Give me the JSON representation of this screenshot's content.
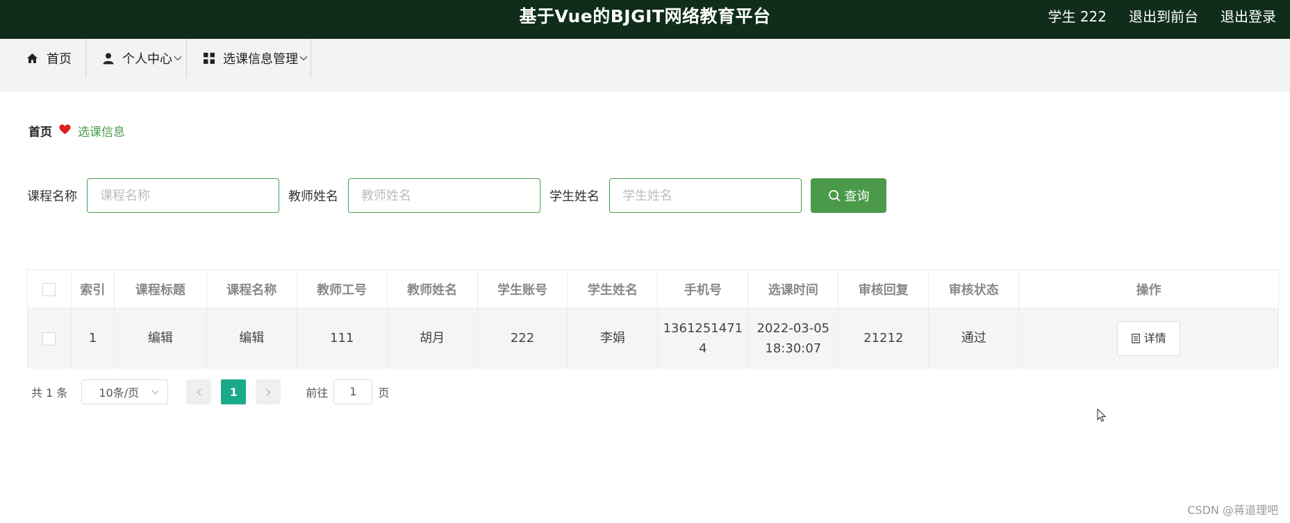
{
  "header": {
    "title": "基于Vue的BJGIT网络教育平台",
    "user": "学生 222",
    "back_to_front": "退出到前台",
    "logout": "退出登录"
  },
  "nav": {
    "items": [
      {
        "label": "首页",
        "icon": "home-icon"
      },
      {
        "label": "个人中心",
        "icon": "user-icon"
      },
      {
        "label": "选课信息管理",
        "icon": "grid-icon"
      }
    ]
  },
  "breadcrumb": {
    "home": "首页",
    "separator_icon": "heart-icon",
    "current": "选课信息"
  },
  "search": {
    "course_label": "课程名称",
    "course_placeholder": "课程名称",
    "teacher_label": "教师姓名",
    "teacher_placeholder": "教师姓名",
    "student_label": "学生姓名",
    "student_placeholder": "学生姓名",
    "query_button": "查询"
  },
  "table": {
    "headers": [
      "索引",
      "课程标题",
      "课程名称",
      "教师工号",
      "教师姓名",
      "学生账号",
      "学生姓名",
      "手机号",
      "选课时间",
      "审核回复",
      "审核状态",
      "操作"
    ],
    "rows": [
      {
        "index": "1",
        "course_title": "编辑",
        "course_name": "编辑",
        "teacher_id": "111",
        "teacher_name": "胡月",
        "student_account": "222",
        "student_name": "李娟",
        "phone_line1": "1361251471",
        "phone_line2": "4",
        "time_line1": "2022-03-05",
        "time_line2": "18:30:07",
        "review_reply": "21212",
        "review_status": "通过",
        "detail_button": "详情"
      }
    ]
  },
  "pagination": {
    "total": "共 1 条",
    "page_size": "10条/页",
    "current_page": "1",
    "goto_label": "前往",
    "goto_value": "1",
    "page_suffix": "页"
  },
  "watermark": "CSDN @蒋道理吧",
  "colors": {
    "header_bg": "#0f2d1a",
    "accent": "#4a9a4a",
    "page_active": "#1aaa8a"
  }
}
